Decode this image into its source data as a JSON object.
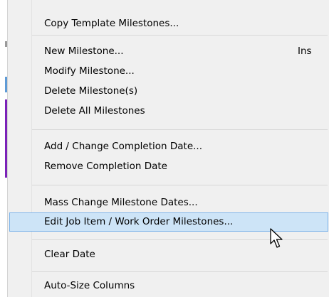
{
  "menu": {
    "items": [
      {
        "label": "Copy Template Milestones..."
      },
      {
        "label": "New Milestone...",
        "shortcut": "Ins"
      },
      {
        "label": "Modify Milestone..."
      },
      {
        "label": "Delete Milestone(s)"
      },
      {
        "label": "Delete All Milestones"
      },
      {
        "label": "Add / Change Completion Date..."
      },
      {
        "label": "Remove Completion Date"
      },
      {
        "label": "Mass Change Milestone Dates..."
      },
      {
        "label": "Edit Job Item / Work Order Milestones...",
        "highlighted": true
      },
      {
        "label": "Clear Date"
      },
      {
        "label": "Auto-Size Columns"
      }
    ],
    "highlight_color": "#cde4f7",
    "highlight_border": "#7eb4ea"
  },
  "cursor": {
    "icon": "mouse-pointer-icon"
  }
}
